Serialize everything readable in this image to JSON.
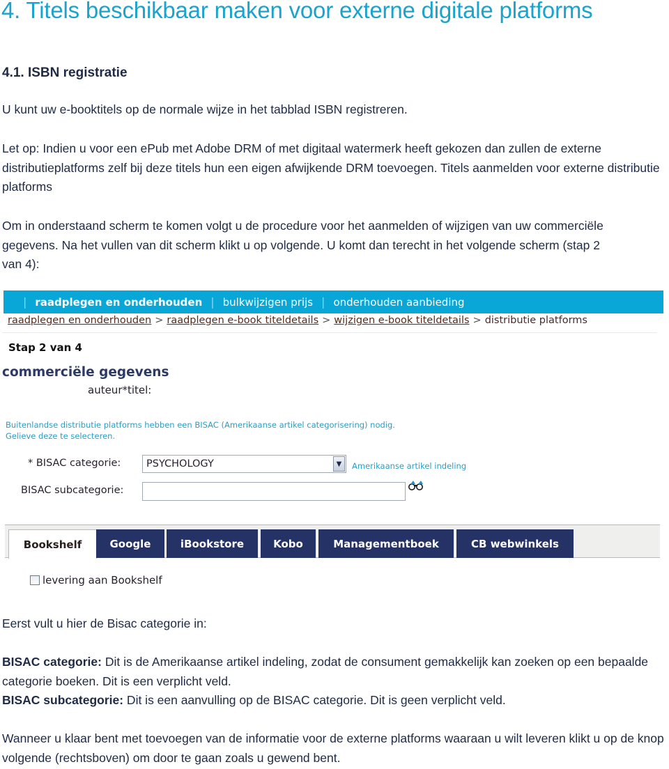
{
  "document": {
    "heading": "4. Titels beschikbaar maken voor externe digitale platforms",
    "subheading": "4.1. ISBN registratie",
    "paragraphs": {
      "p1": "U kunt uw e-booktitels op de normale wijze in het tabblad ISBN registreren.",
      "p2": "Let op: Indien u voor een ePub met Adobe DRM of met digitaal watermerk heeft gekozen dan zullen de externe distributieplatforms zelf bij deze titels hun een eigen afwijkende DRM toevoegen. Titels aanmelden voor externe distributie platforms",
      "p3": "Om in onderstaand scherm te komen volgt u de procedure voor het aanmelden of wijzigen van uw commerciële gegevens. Na het vullen van dit scherm klikt u op volgende. U komt dan terecht in het volgende scherm (stap 2 van 4):",
      "p4": "Eerst vult u hier de Bisac categorie in:",
      "p5_label": "BISAC categorie:",
      "p5_text": " Dit is de Amerikaanse artikel indeling, zodat de consument gemakkelijk kan zoeken op een bepaalde categorie boeken. Dit is een verplicht veld.",
      "p6_label": "BISAC subcategorie:",
      "p6_text": " Dit is een aanvulling op de BISAC categorie. Dit is geen verplicht veld.",
      "p7": "Wanneer u klaar bent met toevoegen van de informatie voor de externe platforms waaraan u wilt leveren klikt u op de knop volgende (rechtsboven) om door te gaan zoals u gewend bent."
    }
  },
  "screenshot": {
    "nav": {
      "items": [
        "raadplegen en onderhouden",
        "bulkwijzigen prijs",
        "onderhouden aanbieding"
      ],
      "separator": "|"
    },
    "breadcrumb": {
      "links": [
        "raadplegen en onderhouden",
        "raadplegen e-book titeldetails",
        "wijzigen e-book titeldetails"
      ],
      "current": "distributie platforms",
      "separator": ">"
    },
    "step": "Stap 2 van 4",
    "section_title": "commerciële gegevens",
    "auteur_titel": "auteur*titel:",
    "info": {
      "line1": "Buitenlandse distributie platforms hebben een BISAC (Amerikaanse artikel categorisering) nodig.",
      "line2": "Gelieve deze te selecteren."
    },
    "form": {
      "category_label": "* BISAC categorie:",
      "category_value": "PSYCHOLOGY",
      "category_hint": "Amerikaanse artikel indeling",
      "subcategory_label": "BISAC subcategorie:",
      "subcategory_value": ""
    },
    "tabs": [
      "Bookshelf",
      "Google",
      "iBookstore",
      "Kobo",
      "Managementboek",
      "CB webwinkels"
    ],
    "active_tab": "Bookshelf",
    "checkbox_label": "levering aan Bookshelf",
    "checkbox_checked": false
  },
  "colors": {
    "heading": "#1aa3cc",
    "nav_bar": "#08a7d8",
    "tab_dark": "#243266",
    "info_text": "#2a9ec6"
  }
}
